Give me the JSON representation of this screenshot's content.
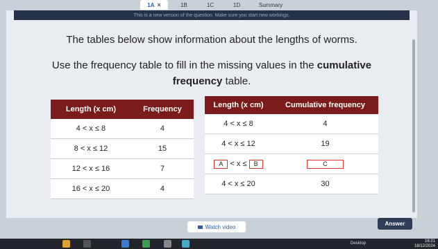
{
  "tabs": [
    {
      "label": "1A",
      "close": "×",
      "active": true
    },
    {
      "label": "1B"
    },
    {
      "label": "1C"
    },
    {
      "label": "1D"
    },
    {
      "label": "Summary"
    }
  ],
  "banner": "This is a new version of the question. Make sure you start new workings.",
  "question": {
    "line1": "The tables below show information about the lengths of worms.",
    "line2_pre": "Use the frequency table to fill in the missing values in the ",
    "line2_bold": "cumulative",
    "line3_bold": "frequency",
    "line3_post": " table."
  },
  "freq_table": {
    "headers": [
      "Length (x cm)",
      "Frequency"
    ],
    "rows": [
      [
        "4 < x ≤ 8",
        "4"
      ],
      [
        "8 < x ≤ 12",
        "15"
      ],
      [
        "12 < x ≤ 16",
        "7"
      ],
      [
        "16 < x ≤ 20",
        "4"
      ]
    ]
  },
  "cum_table": {
    "headers": [
      "Length (x cm)",
      "Cumulative frequency"
    ],
    "rows": [
      {
        "len": "4 < x ≤ 8",
        "cf": "4"
      },
      {
        "len": "4 < x ≤ 12",
        "cf": "19"
      },
      {
        "len_a": "A",
        "len_mid": " < x ≤ ",
        "len_b": "B",
        "cf_box": "C"
      },
      {
        "len": "4 < x ≤ 20",
        "cf": "30"
      }
    ]
  },
  "buttons": {
    "video": "Watch video",
    "answer": "Answer"
  },
  "taskbar": {
    "desktop": "Desktop",
    "time": "16:21",
    "date": "18/12/2024"
  }
}
